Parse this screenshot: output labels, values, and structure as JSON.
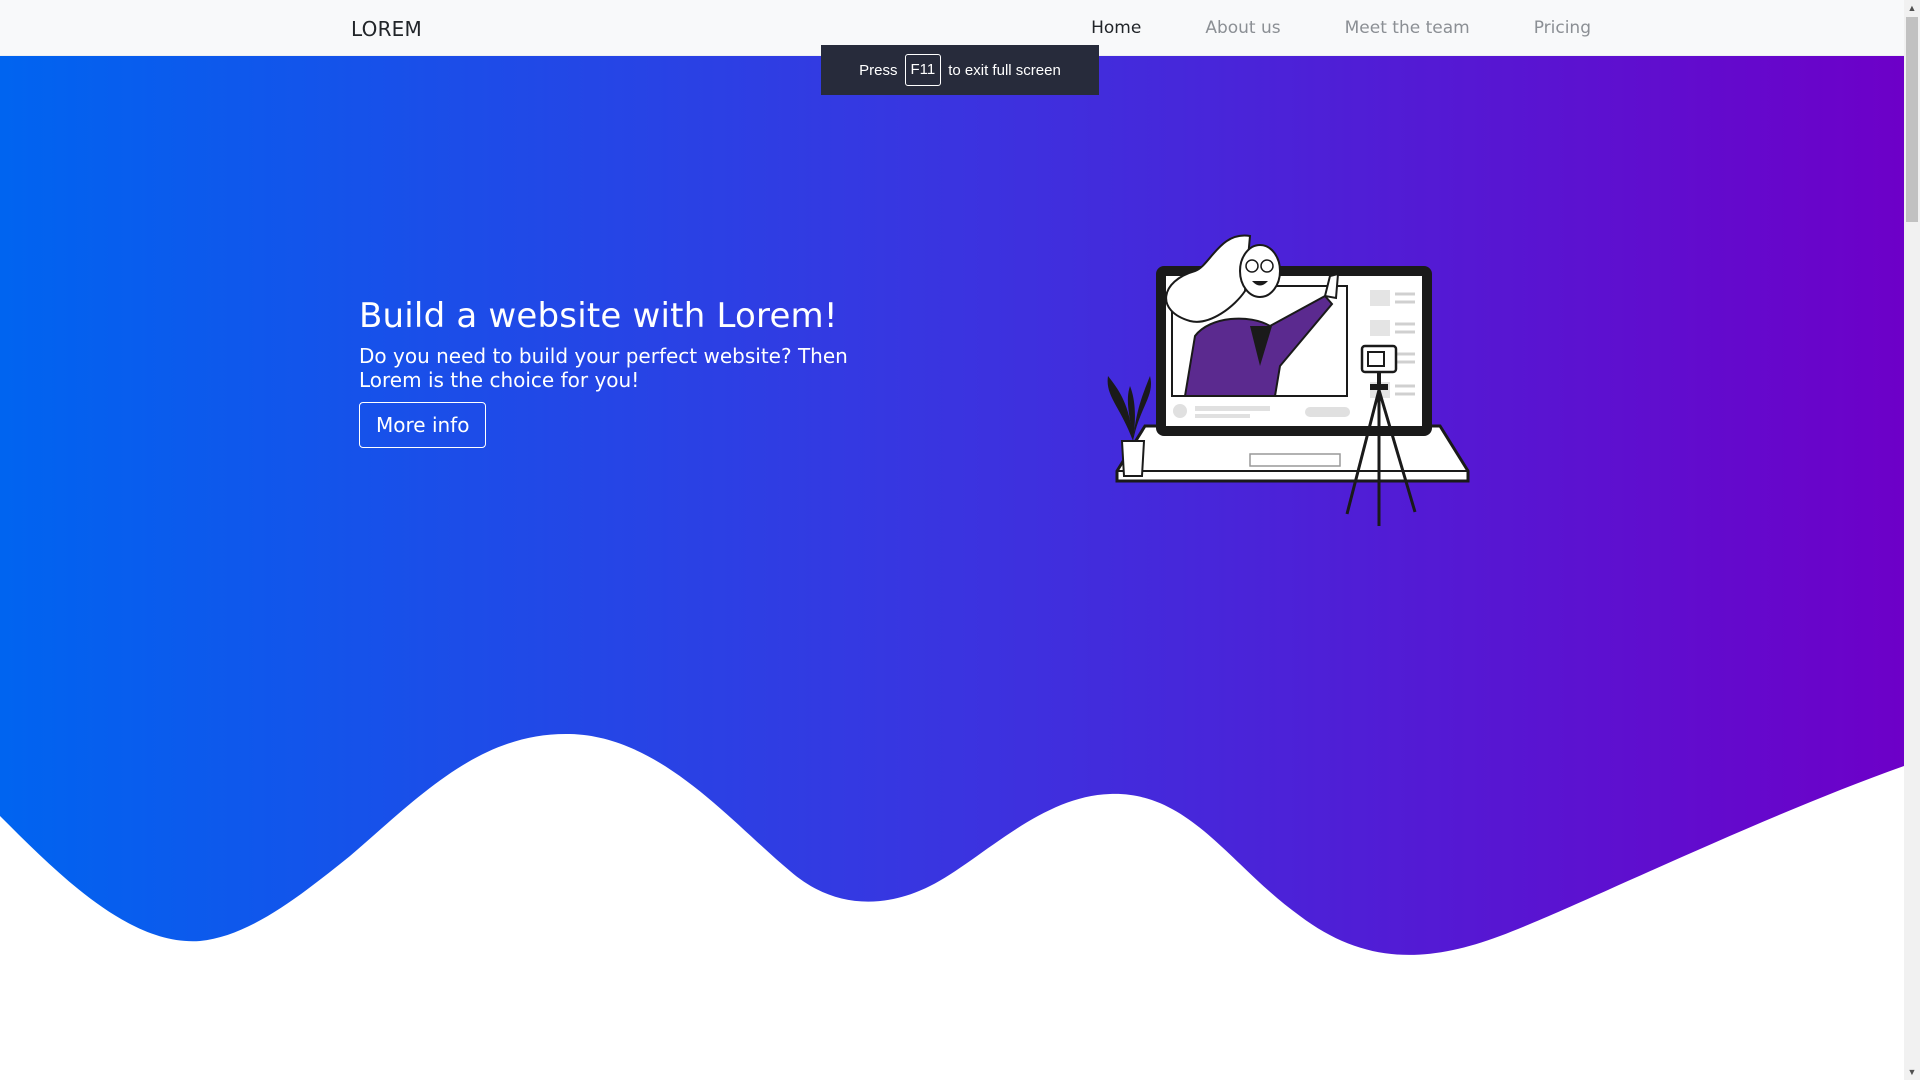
{
  "navbar": {
    "brand": "LOREM",
    "links": [
      {
        "label": "Home",
        "active": true
      },
      {
        "label": "About us",
        "active": false
      },
      {
        "label": "Meet the team",
        "active": false
      },
      {
        "label": "Pricing",
        "active": false
      }
    ]
  },
  "fullscreen_notice": {
    "prefix": "Press",
    "key": "F11",
    "suffix": "to exit full screen"
  },
  "hero": {
    "title": "Build a website with Lorem!",
    "subtitle": "Do you need to build your perfect website? Then Lorem is the choice for you!",
    "button_label": "More info"
  },
  "colors": {
    "gradient_start": "#0064f0",
    "gradient_mid": "#3a34e0",
    "gradient_end": "#6d00c8",
    "navbar_bg": "#f8f9fa",
    "accent_purple": "#5b2a8f"
  },
  "icons": {
    "scroll_up": "scroll-up-arrow-icon",
    "scroll_down": "scroll-down-arrow-icon"
  }
}
